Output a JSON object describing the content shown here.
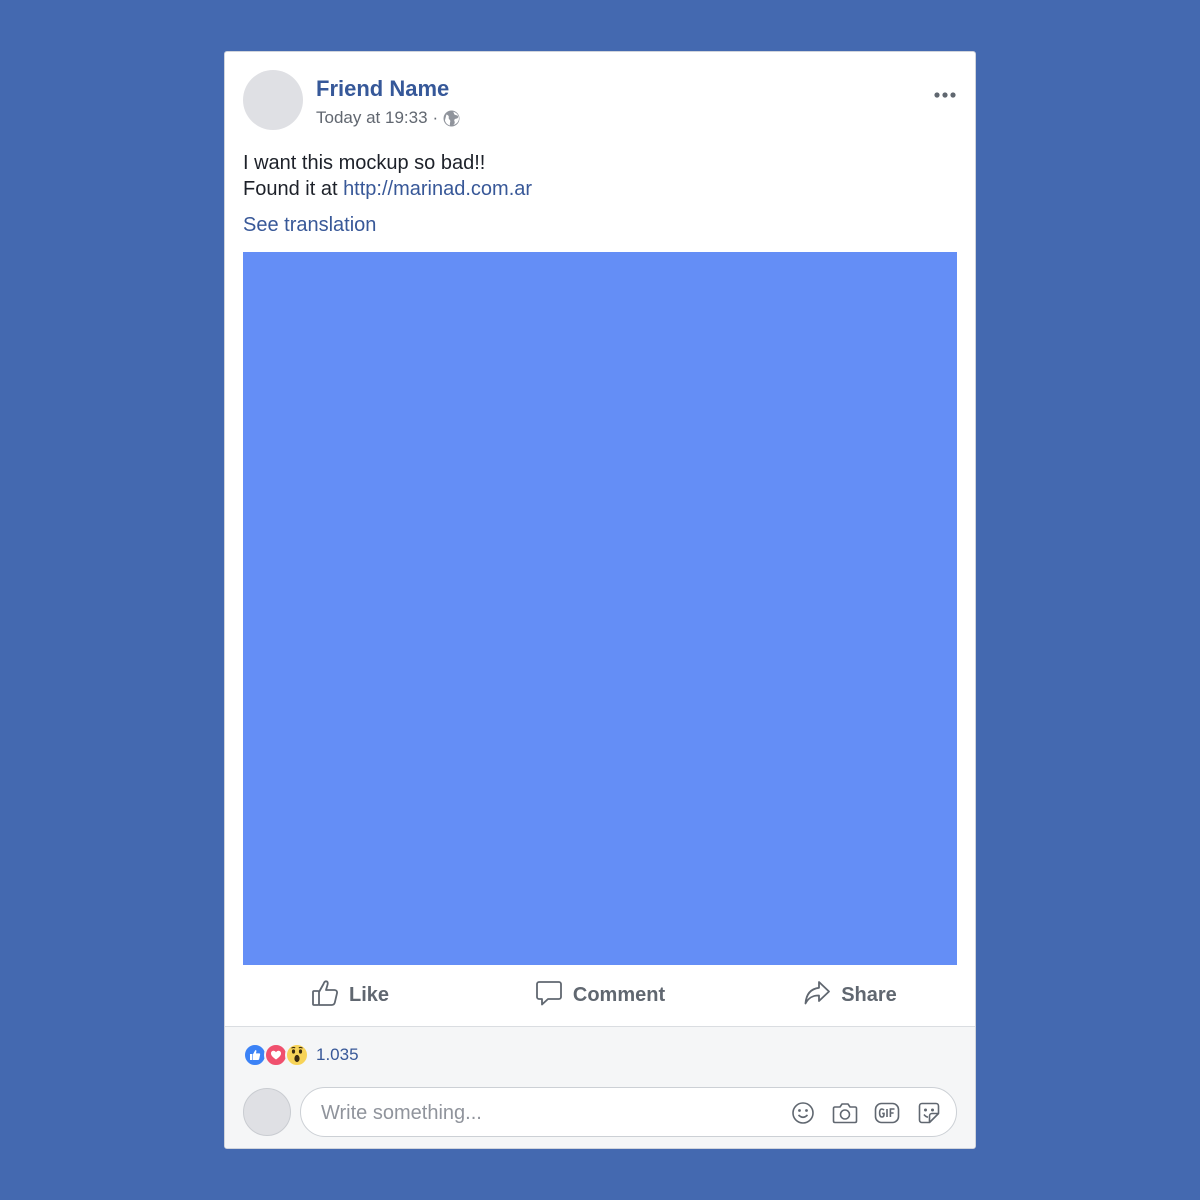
{
  "post": {
    "author_name": "Friend Name",
    "timestamp": "Today at 19:33",
    "separator": "·",
    "privacy_icon": "globe-icon",
    "options_icon": "more-options-icon",
    "text_line1": "I want this mockup so bad!!",
    "text_line2_prefix": "Found it at ",
    "link_text": "http://marinad.com.ar",
    "see_translation": "See translation",
    "media_color": "#648ef6"
  },
  "actions": {
    "like_label": "Like",
    "comment_label": "Comment",
    "share_label": "Share"
  },
  "reactions": {
    "icons": [
      "like-reaction-icon",
      "love-reaction-icon",
      "wow-reaction-icon"
    ],
    "count": "1.035"
  },
  "comment": {
    "placeholder": "Write something...",
    "tools": [
      "emoji-icon",
      "camera-icon",
      "gif-icon",
      "sticker-icon"
    ]
  },
  "colors": {
    "page_background": "#4469b0",
    "name_link": "#365899",
    "like_blue": "#3b82f6",
    "love_red": "#f0506e",
    "wow_yellow": "#f7d358"
  }
}
